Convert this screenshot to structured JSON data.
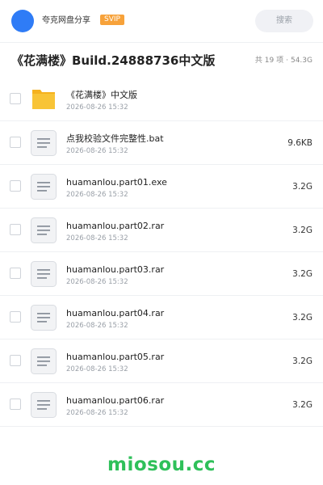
{
  "header": {
    "share_name": "夸克网盘分享",
    "badge": "SVIP",
    "search_placeholder": "搜索"
  },
  "title": "《花满楼》Build.24888736中文版",
  "meta": {
    "count": "共 19 项",
    "separator": "·",
    "total_size": "54.3G"
  },
  "files": [
    {
      "name": "《花满楼》中文版",
      "date": "2026-08-26 15:32",
      "size": "",
      "icon": "folder-icon"
    },
    {
      "name": "点我校验文件完整性.bat",
      "date": "2026-08-26 15:32",
      "size": "9.6KB",
      "icon": "document-icon"
    },
    {
      "name": "huamanlou.part01.exe",
      "date": "2026-08-26 15:32",
      "size": "3.2G",
      "icon": "document-icon"
    },
    {
      "name": "huamanlou.part02.rar",
      "date": "2026-08-26 15:32",
      "size": "3.2G",
      "icon": "document-icon"
    },
    {
      "name": "huamanlou.part03.rar",
      "date": "2026-08-26 15:32",
      "size": "3.2G",
      "icon": "document-icon"
    },
    {
      "name": "huamanlou.part04.rar",
      "date": "2026-08-26 15:32",
      "size": "3.2G",
      "icon": "document-icon"
    },
    {
      "name": "huamanlou.part05.rar",
      "date": "2026-08-26 15:32",
      "size": "3.2G",
      "icon": "document-icon"
    },
    {
      "name": "huamanlou.part06.rar",
      "date": "2026-08-26 15:32",
      "size": "3.2G",
      "icon": "document-icon"
    }
  ],
  "watermark": "miosou.cc",
  "colors": {
    "accent": "#2f7cf6",
    "badge": "#f7a23a",
    "folder": "#f8c437",
    "watermark": "#2fc05a"
  }
}
